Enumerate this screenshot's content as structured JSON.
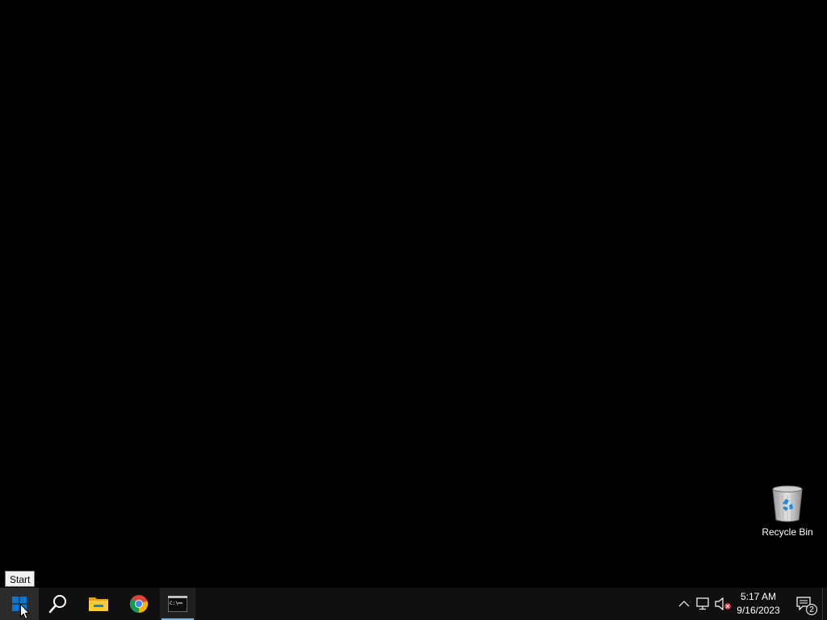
{
  "desktop": {
    "icons": [
      {
        "label": "Recycle Bin",
        "icon": "recycle-bin-icon"
      }
    ]
  },
  "tooltip": {
    "text": "Start"
  },
  "taskbar": {
    "buttons": [
      {
        "name": "start",
        "icon": "windows-logo-icon"
      },
      {
        "name": "search",
        "icon": "search-icon"
      },
      {
        "name": "file-explorer",
        "icon": "folder-icon"
      },
      {
        "name": "chrome",
        "icon": "chrome-icon"
      },
      {
        "name": "command-prompt",
        "icon": "terminal-icon",
        "active": true
      }
    ],
    "tray": {
      "icons": [
        "chevron-up-icon",
        "network-icon",
        "volume-muted-icon"
      ],
      "clock": {
        "time": "5:17 AM",
        "date": "9/16/2023"
      },
      "notifications": {
        "count": "2",
        "icon": "notification-icon"
      }
    }
  },
  "colors": {
    "desktop_bg": "#000000",
    "taskbar_bg": "#101010",
    "accent": "#76b9ed",
    "windows_blue": "#0078d7"
  }
}
